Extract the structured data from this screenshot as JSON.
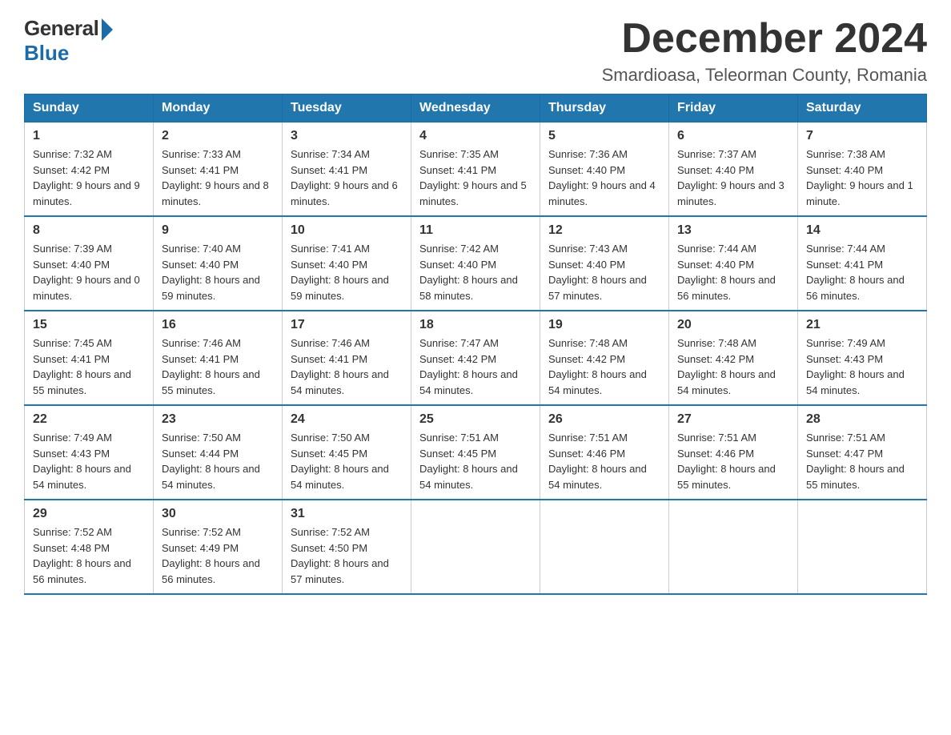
{
  "logo": {
    "general": "General",
    "blue": "Blue"
  },
  "title": "December 2024",
  "location": "Smardioasa, Teleorman County, Romania",
  "weekdays": [
    "Sunday",
    "Monday",
    "Tuesday",
    "Wednesday",
    "Thursday",
    "Friday",
    "Saturday"
  ],
  "weeks": [
    [
      {
        "day": "1",
        "sunrise": "7:32 AM",
        "sunset": "4:42 PM",
        "daylight": "9 hours and 9 minutes."
      },
      {
        "day": "2",
        "sunrise": "7:33 AM",
        "sunset": "4:41 PM",
        "daylight": "9 hours and 8 minutes."
      },
      {
        "day": "3",
        "sunrise": "7:34 AM",
        "sunset": "4:41 PM",
        "daylight": "9 hours and 6 minutes."
      },
      {
        "day": "4",
        "sunrise": "7:35 AM",
        "sunset": "4:41 PM",
        "daylight": "9 hours and 5 minutes."
      },
      {
        "day": "5",
        "sunrise": "7:36 AM",
        "sunset": "4:40 PM",
        "daylight": "9 hours and 4 minutes."
      },
      {
        "day": "6",
        "sunrise": "7:37 AM",
        "sunset": "4:40 PM",
        "daylight": "9 hours and 3 minutes."
      },
      {
        "day": "7",
        "sunrise": "7:38 AM",
        "sunset": "4:40 PM",
        "daylight": "9 hours and 1 minute."
      }
    ],
    [
      {
        "day": "8",
        "sunrise": "7:39 AM",
        "sunset": "4:40 PM",
        "daylight": "9 hours and 0 minutes."
      },
      {
        "day": "9",
        "sunrise": "7:40 AM",
        "sunset": "4:40 PM",
        "daylight": "8 hours and 59 minutes."
      },
      {
        "day": "10",
        "sunrise": "7:41 AM",
        "sunset": "4:40 PM",
        "daylight": "8 hours and 59 minutes."
      },
      {
        "day": "11",
        "sunrise": "7:42 AM",
        "sunset": "4:40 PM",
        "daylight": "8 hours and 58 minutes."
      },
      {
        "day": "12",
        "sunrise": "7:43 AM",
        "sunset": "4:40 PM",
        "daylight": "8 hours and 57 minutes."
      },
      {
        "day": "13",
        "sunrise": "7:44 AM",
        "sunset": "4:40 PM",
        "daylight": "8 hours and 56 minutes."
      },
      {
        "day": "14",
        "sunrise": "7:44 AM",
        "sunset": "4:41 PM",
        "daylight": "8 hours and 56 minutes."
      }
    ],
    [
      {
        "day": "15",
        "sunrise": "7:45 AM",
        "sunset": "4:41 PM",
        "daylight": "8 hours and 55 minutes."
      },
      {
        "day": "16",
        "sunrise": "7:46 AM",
        "sunset": "4:41 PM",
        "daylight": "8 hours and 55 minutes."
      },
      {
        "day": "17",
        "sunrise": "7:46 AM",
        "sunset": "4:41 PM",
        "daylight": "8 hours and 54 minutes."
      },
      {
        "day": "18",
        "sunrise": "7:47 AM",
        "sunset": "4:42 PM",
        "daylight": "8 hours and 54 minutes."
      },
      {
        "day": "19",
        "sunrise": "7:48 AM",
        "sunset": "4:42 PM",
        "daylight": "8 hours and 54 minutes."
      },
      {
        "day": "20",
        "sunrise": "7:48 AM",
        "sunset": "4:42 PM",
        "daylight": "8 hours and 54 minutes."
      },
      {
        "day": "21",
        "sunrise": "7:49 AM",
        "sunset": "4:43 PM",
        "daylight": "8 hours and 54 minutes."
      }
    ],
    [
      {
        "day": "22",
        "sunrise": "7:49 AM",
        "sunset": "4:43 PM",
        "daylight": "8 hours and 54 minutes."
      },
      {
        "day": "23",
        "sunrise": "7:50 AM",
        "sunset": "4:44 PM",
        "daylight": "8 hours and 54 minutes."
      },
      {
        "day": "24",
        "sunrise": "7:50 AM",
        "sunset": "4:45 PM",
        "daylight": "8 hours and 54 minutes."
      },
      {
        "day": "25",
        "sunrise": "7:51 AM",
        "sunset": "4:45 PM",
        "daylight": "8 hours and 54 minutes."
      },
      {
        "day": "26",
        "sunrise": "7:51 AM",
        "sunset": "4:46 PM",
        "daylight": "8 hours and 54 minutes."
      },
      {
        "day": "27",
        "sunrise": "7:51 AM",
        "sunset": "4:46 PM",
        "daylight": "8 hours and 55 minutes."
      },
      {
        "day": "28",
        "sunrise": "7:51 AM",
        "sunset": "4:47 PM",
        "daylight": "8 hours and 55 minutes."
      }
    ],
    [
      {
        "day": "29",
        "sunrise": "7:52 AM",
        "sunset": "4:48 PM",
        "daylight": "8 hours and 56 minutes."
      },
      {
        "day": "30",
        "sunrise": "7:52 AM",
        "sunset": "4:49 PM",
        "daylight": "8 hours and 56 minutes."
      },
      {
        "day": "31",
        "sunrise": "7:52 AM",
        "sunset": "4:50 PM",
        "daylight": "8 hours and 57 minutes."
      },
      null,
      null,
      null,
      null
    ]
  ],
  "labels": {
    "sunrise": "Sunrise: ",
    "sunset": "Sunset: ",
    "daylight": "Daylight: "
  }
}
